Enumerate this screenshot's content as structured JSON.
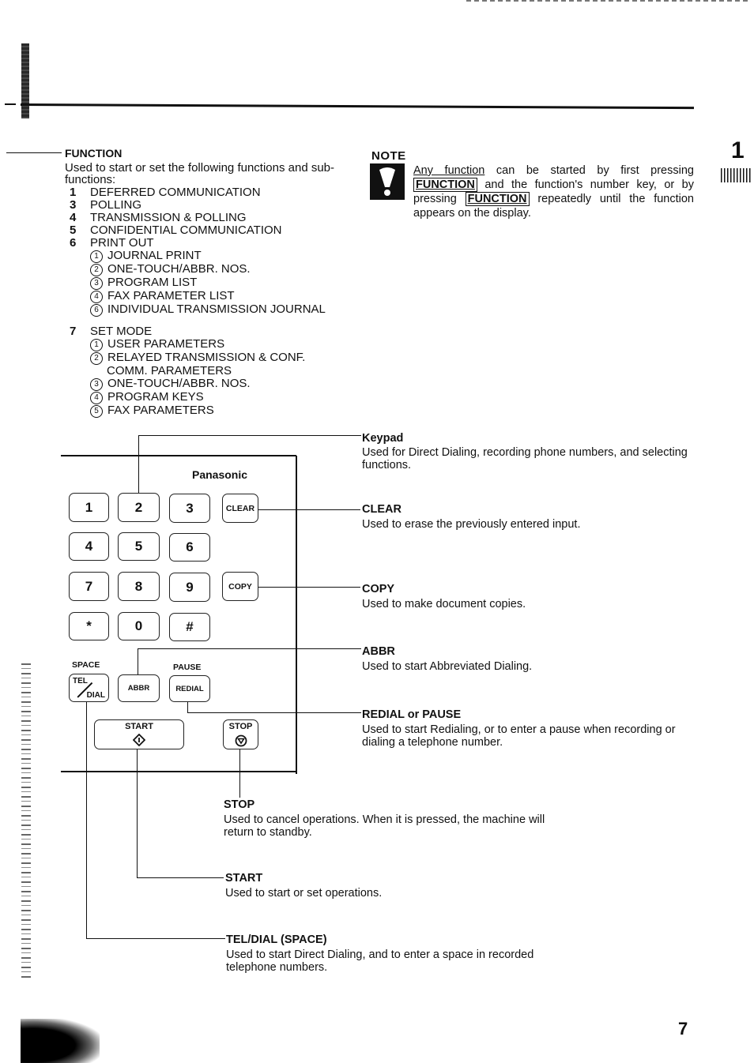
{
  "page": {
    "chapter_number": "1",
    "page_number": "7"
  },
  "function_section": {
    "title": "FUNCTION",
    "description": "Used to start or set the following functions and sub-functions:",
    "items": [
      {
        "num": "1",
        "label": "DEFERRED COMMUNICATION"
      },
      {
        "num": "3",
        "label": "POLLING"
      },
      {
        "num": "4",
        "label": "TRANSMISSION & POLLING"
      },
      {
        "num": "5",
        "label": "CONFIDENTIAL COMMUNICATION"
      },
      {
        "num": "6",
        "label": "PRINT OUT"
      }
    ],
    "print_out_subitems": [
      {
        "num": "1",
        "label": "JOURNAL PRINT"
      },
      {
        "num": "2",
        "label": "ONE-TOUCH/ABBR. NOS."
      },
      {
        "num": "3",
        "label": "PROGRAM LIST"
      },
      {
        "num": "4",
        "label": "FAX PARAMETER LIST"
      },
      {
        "num": "6",
        "label": "INDIVIDUAL TRANSMISSION JOURNAL"
      }
    ],
    "set_mode": {
      "num": "7",
      "label": "SET MODE"
    },
    "set_mode_subitems": [
      {
        "num": "1",
        "label": "USER PARAMETERS"
      },
      {
        "num": "2",
        "label": "RELAYED TRANSMISSION & CONF.",
        "continuation": "COMM. PARAMETERS"
      },
      {
        "num": "3",
        "label": "ONE-TOUCH/ABBR. NOS."
      },
      {
        "num": "4",
        "label": "PROGRAM KEYS"
      },
      {
        "num": "5",
        "label": "FAX PARAMETERS"
      }
    ]
  },
  "note": {
    "label": "NOTE",
    "icon": "exclamation-icon",
    "text_part1": "Any function",
    "text_part2": " can be started by first pressing ",
    "key1": "FUNCTION",
    "text_part3": " and the function's number key, or by pressing ",
    "key2": "FUNCTION",
    "text_part4": " repeatedly until the function appears on the display."
  },
  "panel": {
    "brand": "Panasonic",
    "keys": {
      "k1": "1",
      "k2": "2",
      "k3": "3",
      "clear": "CLEAR",
      "k4": "4",
      "k5": "5",
      "k6": "6",
      "k7": "7",
      "k8": "8",
      "k9": "9",
      "copy": "COPY",
      "star": "*",
      "k0": "0",
      "hash": "#",
      "tel": "TEL",
      "dial": "DIAL",
      "abbr": "ABBR",
      "redial": "REDIAL",
      "start": "START",
      "stop": "STOP"
    },
    "key_labels": {
      "space": "SPACE",
      "pause": "PAUSE"
    }
  },
  "callouts": {
    "keypad": {
      "title": "Keypad",
      "desc": "Used for Direct Dialing, recording phone numbers, and selecting functions."
    },
    "clear": {
      "title": "CLEAR",
      "desc": "Used to erase the previously entered input."
    },
    "copy": {
      "title": "COPY",
      "desc": "Used to make document copies."
    },
    "abbr": {
      "title": "ABBR",
      "desc": "Used to start Abbreviated Dialing."
    },
    "redial": {
      "title": "REDIAL or PAUSE",
      "desc": "Used to start Redialing, or to enter a pause when recording or dialing a telephone number."
    },
    "stop": {
      "title": "STOP",
      "desc": "Used to cancel operations. When it is pressed, the machine will return to standby."
    },
    "start": {
      "title": "START",
      "desc": "Used to start or set operations."
    },
    "teldial": {
      "title": "TEL/DIAL (SPACE)",
      "desc": "Used to start Direct Dialing, and to enter a space in recorded telephone numbers."
    }
  }
}
